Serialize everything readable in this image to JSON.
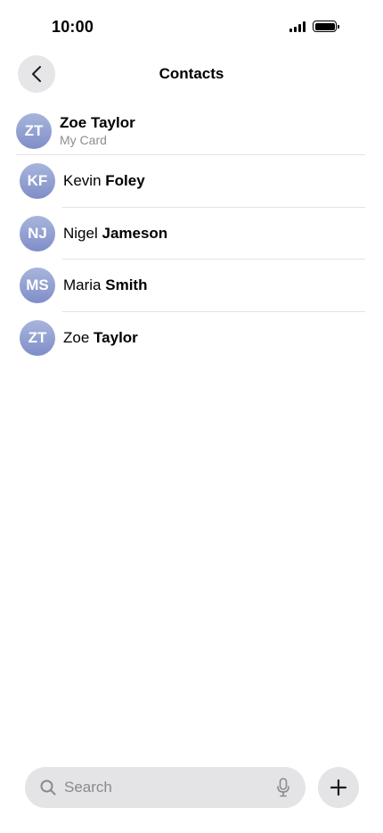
{
  "status_bar": {
    "time": "10:00"
  },
  "nav": {
    "title": "Contacts"
  },
  "my_card": {
    "initials": "ZT",
    "name": "Zoe Taylor",
    "subtitle": "My Card"
  },
  "contacts": [
    {
      "initials": "KF",
      "first": "Kevin",
      "last": "Foley"
    },
    {
      "initials": "NJ",
      "first": "Nigel",
      "last": "Jameson"
    },
    {
      "initials": "MS",
      "first": "Maria",
      "last": "Smith"
    },
    {
      "initials": "ZT",
      "first": "Zoe",
      "last": "Taylor"
    }
  ],
  "search": {
    "placeholder": "Search"
  },
  "icons": {
    "back": "chevron-left-icon",
    "search": "magnifier-icon",
    "mic": "microphone-icon",
    "add": "plus-icon"
  },
  "colors": {
    "avatar_top": "#a8b5dc",
    "avatar_bottom": "#7f8ec8",
    "pill_bg": "#e4e4e6"
  }
}
